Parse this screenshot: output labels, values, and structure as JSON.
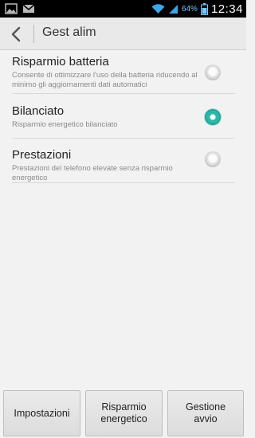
{
  "status_bar": {
    "left_icons": [
      "image-icon",
      "mail-icon"
    ],
    "battery_percent": "64%",
    "time": "12:34"
  },
  "title_bar": {
    "back_icon": "chevron-left-icon",
    "title": "Gest alim"
  },
  "options": [
    {
      "title": "Risparmio batteria",
      "subtitle": "Consente di ottimizzare l'uso della batteria riducendo al minimo gli aggiornamenti dati automatici",
      "selected": false
    },
    {
      "title": "Bilanciato",
      "subtitle": "Risparmio energetico bilanciato",
      "selected": true
    },
    {
      "title": "Prestazioni",
      "subtitle": "Prestazioni del telefono elevate senza risparmio energetico",
      "selected": false
    }
  ],
  "bottom_buttons": {
    "settings": "Impostazioni",
    "energy_saving_line1": "Risparmio",
    "energy_saving_line2": "energetico",
    "startup_line1": "Gestione",
    "startup_line2": "avvio"
  },
  "colors": {
    "accent": "#2bb8a8",
    "battery_text": "#7bc7ff",
    "status_bar_bg": "#000000",
    "background": "#f2f2f2"
  }
}
